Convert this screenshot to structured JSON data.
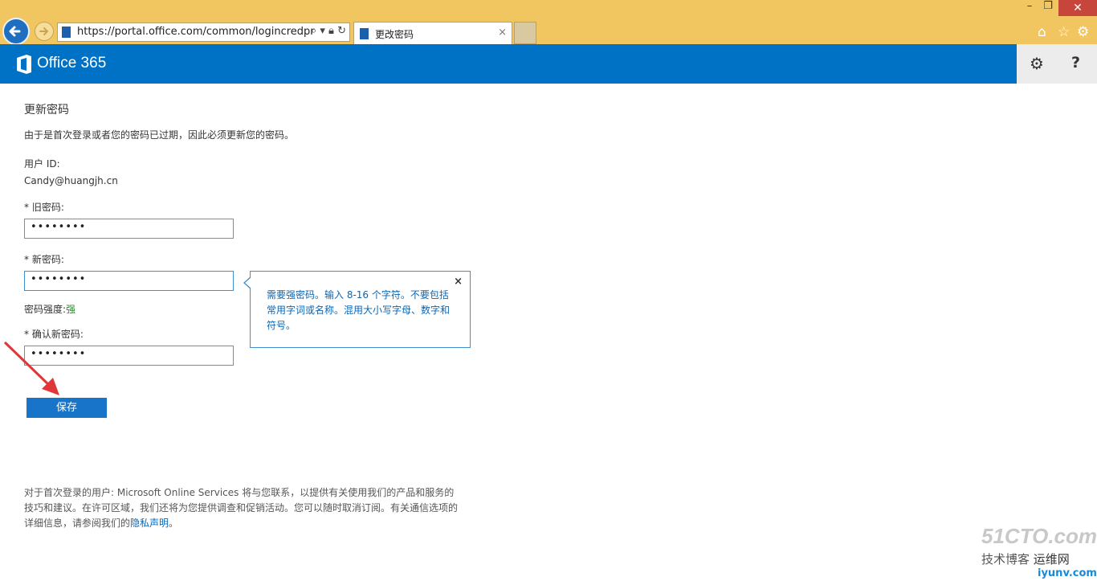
{
  "browser": {
    "url": "https://portal.office.com/common/logincredpr",
    "tab_title": "更改密码",
    "tab_close": "×",
    "window_close": "✕",
    "window_minimize": "–",
    "window_restore": "❐",
    "icons": [
      "back-icon",
      "forward-icon",
      "search-icon",
      "lock-icon",
      "refresh-icon",
      "home-icon",
      "favorites-icon",
      "settings-icon"
    ]
  },
  "header": {
    "app_title": "Office 365",
    "settings_icon": "⚙",
    "help_label": "?",
    "brand_color": "#0072c6"
  },
  "page": {
    "title": "更新密码",
    "description": "由于是首次登录或者您的密码已过期，因此必须更新您的密码。",
    "user_id_label": "用户 ID:",
    "user_id": "Candy@huangjh.cn",
    "old_password_label": "* 旧密码:",
    "old_password_value": "••••••••",
    "new_password_label": "* 新密码:",
    "new_password_value": "••••••••",
    "strength_label": "密码强度:",
    "strength_value": "强",
    "confirm_password_label": "* 确认新密码:",
    "confirm_password_value": "••••••••",
    "save_label": "保存"
  },
  "tooltip": {
    "text": "需要强密码。输入 8-16 个字符。不要包括常用字词或名称。混用大小写字母、数字和符号。",
    "close": "×"
  },
  "footer": {
    "text": "对于首次登录的用户: Microsoft Online Services 将与您联系，以提供有关使用我们的产品和服务的技巧和建议。在许可区域，我们还将为您提供调查和促销活动。您可以随时取消订阅。有关通信选项的详细信息，请参阅我们的",
    "privacy_link": "隐私声明",
    "end": "。"
  },
  "watermark": {
    "line1": "51CTO.com",
    "line2": "技术博客",
    "line3": "运维网",
    "line4": "iyunv.com"
  }
}
